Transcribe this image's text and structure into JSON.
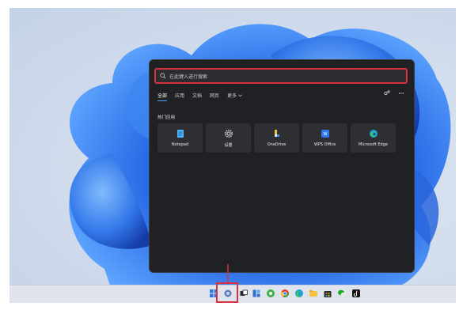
{
  "search": {
    "placeholder": "在此键入进行搜索"
  },
  "tabs": [
    {
      "label": "全部"
    },
    {
      "label": "应用"
    },
    {
      "label": "文档"
    },
    {
      "label": "网页"
    },
    {
      "label": "更多"
    }
  ],
  "section_title": "热门应用",
  "apps": [
    {
      "label": "Notepad",
      "icon": "notepad-icon"
    },
    {
      "label": "设置",
      "icon": "settings-gear-icon"
    },
    {
      "label": "OneDrive",
      "icon": "onedrive-icon"
    },
    {
      "label": "WPS Office",
      "icon": "wps-office-icon"
    },
    {
      "label": "Microsoft Edge",
      "icon": "edge-icon"
    }
  ],
  "colors": {
    "highlight": "#d8323c",
    "panel_bg": "#202124",
    "accent": "#4ea8ff"
  },
  "taskbar": {
    "icons": [
      "start-icon",
      "search-icon",
      "task-view-icon",
      "widgets-icon",
      "chat-icon",
      "chrome-icon",
      "edge-icon",
      "file-explorer-icon",
      "store-icon",
      "wechat-icon",
      "tiktok-icon"
    ]
  }
}
